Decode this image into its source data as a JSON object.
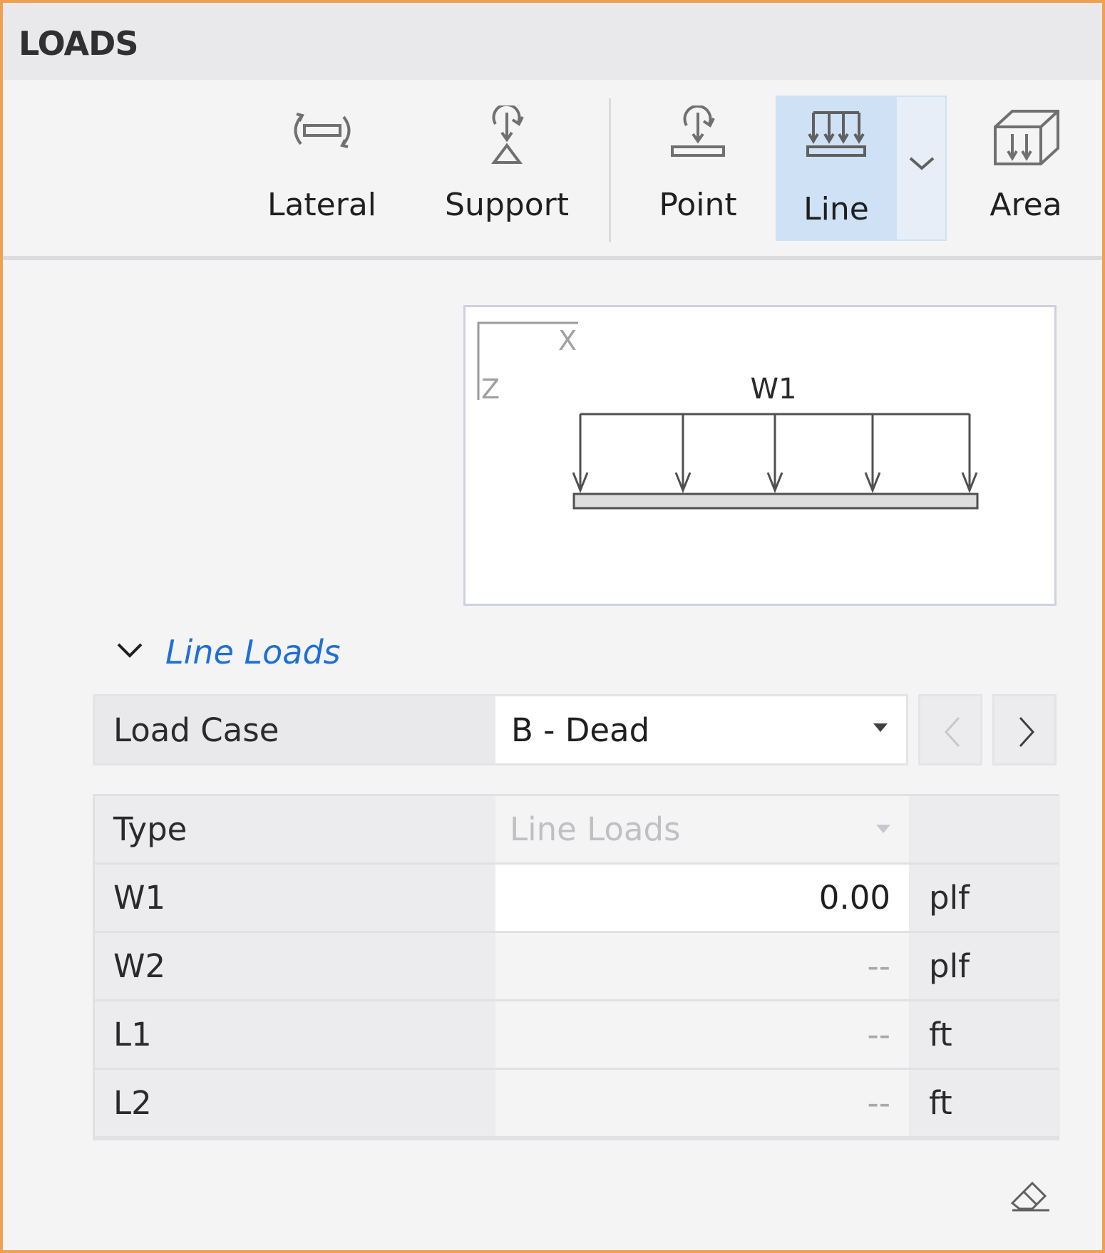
{
  "header": {
    "title": "LOADS"
  },
  "toolbar": {
    "items": [
      {
        "label": "Lateral",
        "icon": "lateral-load-icon"
      },
      {
        "label": "Support",
        "icon": "support-load-icon"
      },
      {
        "label": "Point",
        "icon": "point-load-icon"
      },
      {
        "label": "Line",
        "icon": "line-load-icon",
        "selected": true
      },
      {
        "label": "Area",
        "icon": "area-load-icon"
      }
    ],
    "selected_color": "#cfe1f5"
  },
  "diagram": {
    "axis_x": "X",
    "axis_z": "Z",
    "load_label": "W1"
  },
  "section": {
    "title": "Line Loads",
    "color": "#1e6fd8"
  },
  "load_case": {
    "label": "Load Case",
    "value": "B - Dead"
  },
  "properties": {
    "rows": [
      {
        "label": "Type",
        "value": "Line Loads",
        "unit": ""
      },
      {
        "label": "W1",
        "value": "0.00",
        "unit": "plf"
      },
      {
        "label": "W2",
        "value": "--",
        "unit": "plf"
      },
      {
        "label": "L1",
        "value": "--",
        "unit": "ft"
      },
      {
        "label": "L2",
        "value": "--",
        "unit": "ft"
      }
    ]
  }
}
